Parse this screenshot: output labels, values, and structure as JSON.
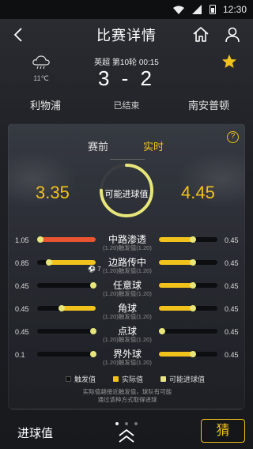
{
  "status_bar": {
    "time": "12:30"
  },
  "nav": {
    "title": "比赛详情"
  },
  "match": {
    "weather_temp": "11℃",
    "league_round_time": "英超 第10轮  00:15",
    "score": "3 - 2",
    "home_team": "利物浦",
    "status": "已结束",
    "away_team": "南安普顿"
  },
  "tabs": [
    {
      "label": "赛前"
    },
    {
      "label": "实时"
    }
  ],
  "help_label": "?",
  "expected_goals": {
    "home": "3.35",
    "label": "可能进球值",
    "away": "4.45",
    "gauge_fraction": 0.75
  },
  "stats": [
    {
      "name": "中路渗透",
      "sub": "(1.20)触发值(1.20)",
      "left": "1.05",
      "right": "0.45",
      "left_fill": 1.0,
      "right_fill": 0.62,
      "left_color": "#e8542f"
    },
    {
      "name": "边路传中",
      "sub": "(1.20)触发值(1.20)",
      "left": "0.85",
      "right": "0.45",
      "left_fill": 0.84,
      "right_fill": 0.62,
      "left_color": "#f2c21c",
      "note": "7"
    },
    {
      "name": "任意球",
      "sub": "(1.20)触发值(1.20)",
      "left": "0.45",
      "right": "0.45",
      "left_fill": 0.08,
      "right_fill": 0.62,
      "left_color": "#f2c21c"
    },
    {
      "name": "角球",
      "sub": "(1.20)触发值(1.20)",
      "left": "0.45",
      "right": "0.45",
      "left_fill": 0.62,
      "right_fill": 0.62,
      "left_color": "#f2c21c"
    },
    {
      "name": "点球",
      "sub": "(1.20)触发值(1.20)",
      "left": "0.45",
      "right": "0.45",
      "left_fill": 0.08,
      "right_fill": 0.08,
      "left_color": "#f2c21c"
    },
    {
      "name": "界外球",
      "sub": "(1.20)触发值(1.20)",
      "left": "0.1",
      "right": "0.45",
      "left_fill": 0.08,
      "right_fill": 0.62,
      "left_color": "#f2c21c"
    }
  ],
  "legend": [
    {
      "label": "触发值",
      "color": "#0d0e10"
    },
    {
      "label": "实际值",
      "color": "#f2c21c"
    },
    {
      "label": "可能进球值",
      "color": "#e7e67a"
    }
  ],
  "footnote": {
    "line1": "实际值越接近触发值，球队有可能",
    "line2": "通过该种方式取得进球"
  },
  "bottom": {
    "label": "进球值",
    "guess_button": "猜"
  },
  "colors": {
    "accent": "#f2c21c",
    "hot": "#e8542f"
  }
}
